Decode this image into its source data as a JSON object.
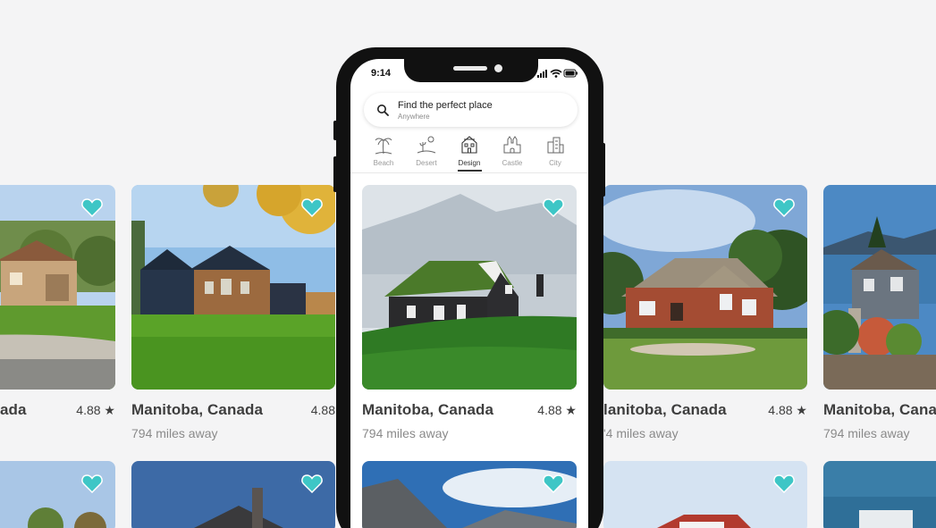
{
  "colors": {
    "accent": "#3ec6c6",
    "background": "#f4f4f5"
  },
  "status": {
    "time": "9:14"
  },
  "search": {
    "title": "Find the perfect place",
    "subtitle": "Anywhere"
  },
  "categories": [
    {
      "label": "Beach",
      "icon": "palm-tree-icon"
    },
    {
      "label": "Desert",
      "icon": "desert-icon"
    },
    {
      "label": "Design",
      "icon": "design-house-icon",
      "active": true
    },
    {
      "label": "Castle",
      "icon": "castle-icon"
    },
    {
      "label": "City",
      "icon": "city-icon"
    }
  ],
  "listings": [
    {
      "place": "ada",
      "rating": "4.88 ★",
      "distance": ""
    },
    {
      "place": "Manitoba, Canada",
      "rating": "4.88",
      "distance": "794 miles away"
    },
    {
      "place": "Manitoba, Canada",
      "rating": "4.88 ★",
      "distance": "794 miles away"
    },
    {
      "place": "lanitoba, Canada",
      "rating": "4.88 ★",
      "distance": "'4 miles away"
    },
    {
      "place": "Manitoba, Canad",
      "rating": "",
      "distance": "794 miles away"
    }
  ]
}
